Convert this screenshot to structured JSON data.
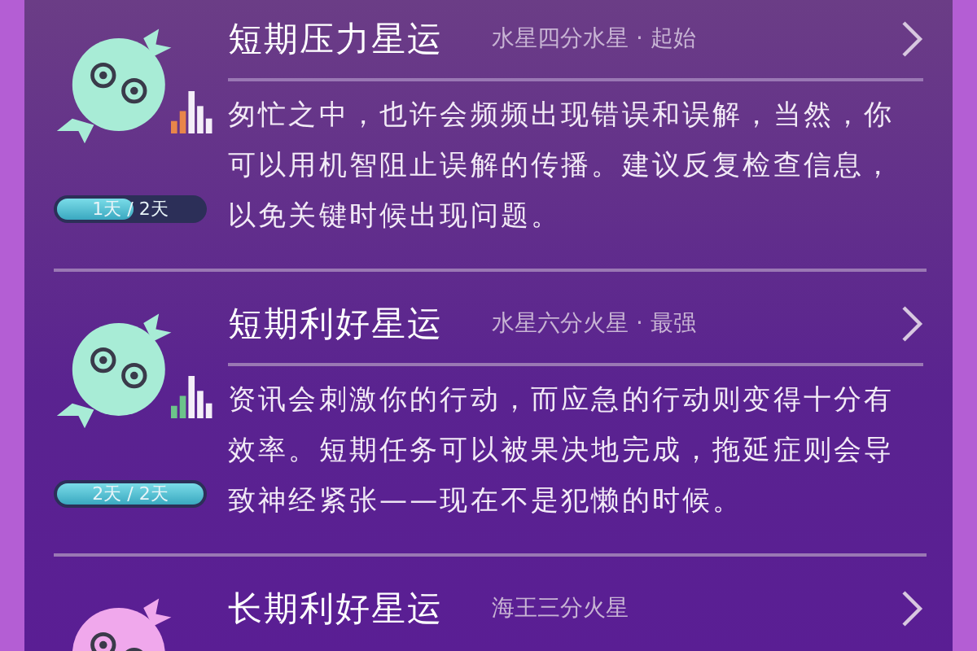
{
  "items": [
    {
      "title": "短期压力星运",
      "subtitle": "水星四分水星 · 起始",
      "avatar": {
        "color": "#a8ecd6"
      },
      "meter": {
        "color": "#e8864a"
      },
      "progress": {
        "label": "1天 / 2天",
        "level": 0.5
      },
      "body": "匆忙之中，也许会频频出现错误和误解，当然，你可以用机智阻止误解的传播。建议反复检查信息，以免关键时候出现问题。"
    },
    {
      "title": "短期利好星运",
      "subtitle": "水星六分火星 · 最强",
      "avatar": {
        "color": "#a8ecd6"
      },
      "meter": {
        "color": "#6cc48a"
      },
      "progress": {
        "label": "2天 / 2天",
        "level": 1
      },
      "body": "资讯会刺激你的行动，而应急的行动则变得十分有效率。短期任务可以被果决地完成，拖延症则会导致神经紧张——现在不是犯懒的时候。"
    },
    {
      "title": "长期利好星运",
      "subtitle": "海王三分火星",
      "avatar": {
        "color": "#f0a8ec"
      }
    }
  ]
}
